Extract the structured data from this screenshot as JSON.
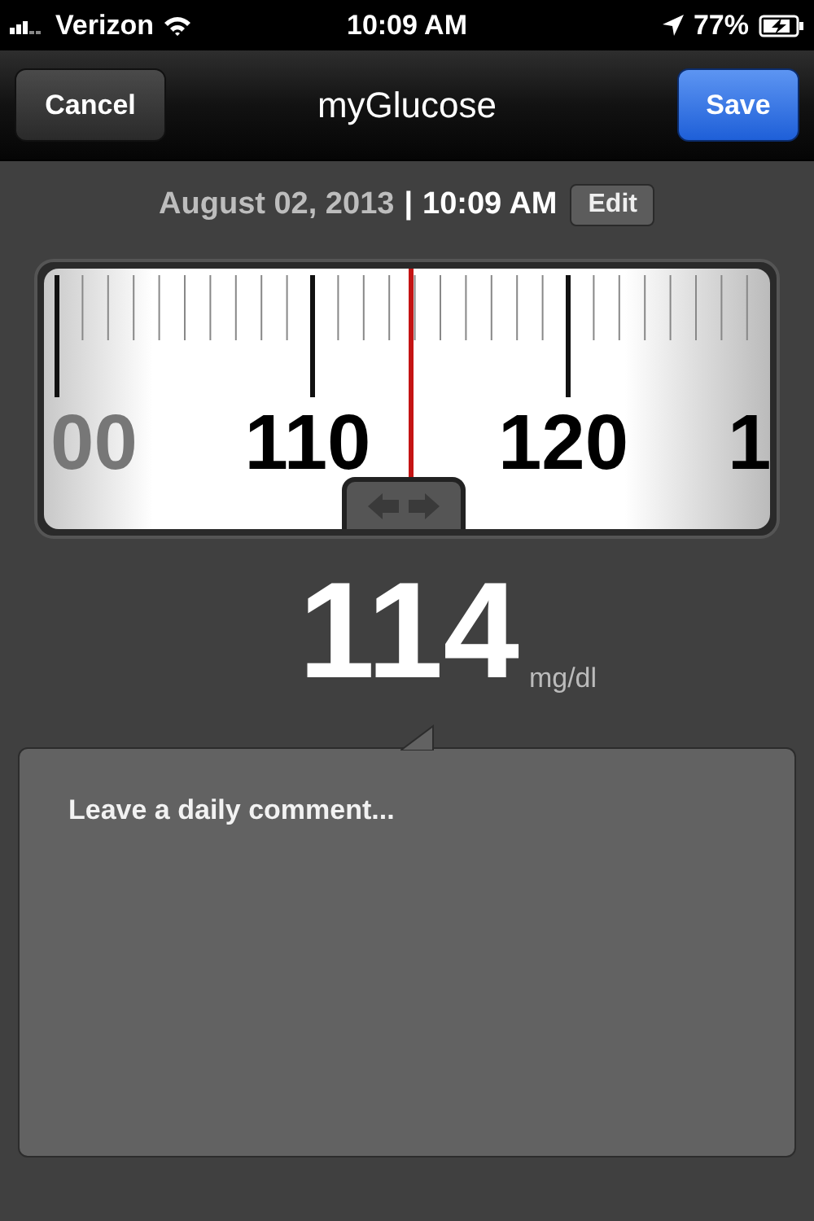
{
  "status_bar": {
    "carrier": "Verizon",
    "time": "10:09 AM",
    "battery": "77%"
  },
  "nav_bar": {
    "left_button": "Cancel",
    "title": "myGlucose",
    "right_button": "Save"
  },
  "reading_date": {
    "date": "August 02, 2013",
    "separator": "|",
    "time": "10:09 AM",
    "edit_button": "Edit"
  },
  "ruler": {
    "labels": [
      "00",
      "110",
      "120",
      "1"
    ]
  },
  "reading": {
    "value": "114",
    "unit": "mg/dl"
  },
  "comment": {
    "placeholder": "Leave a daily comment..."
  }
}
